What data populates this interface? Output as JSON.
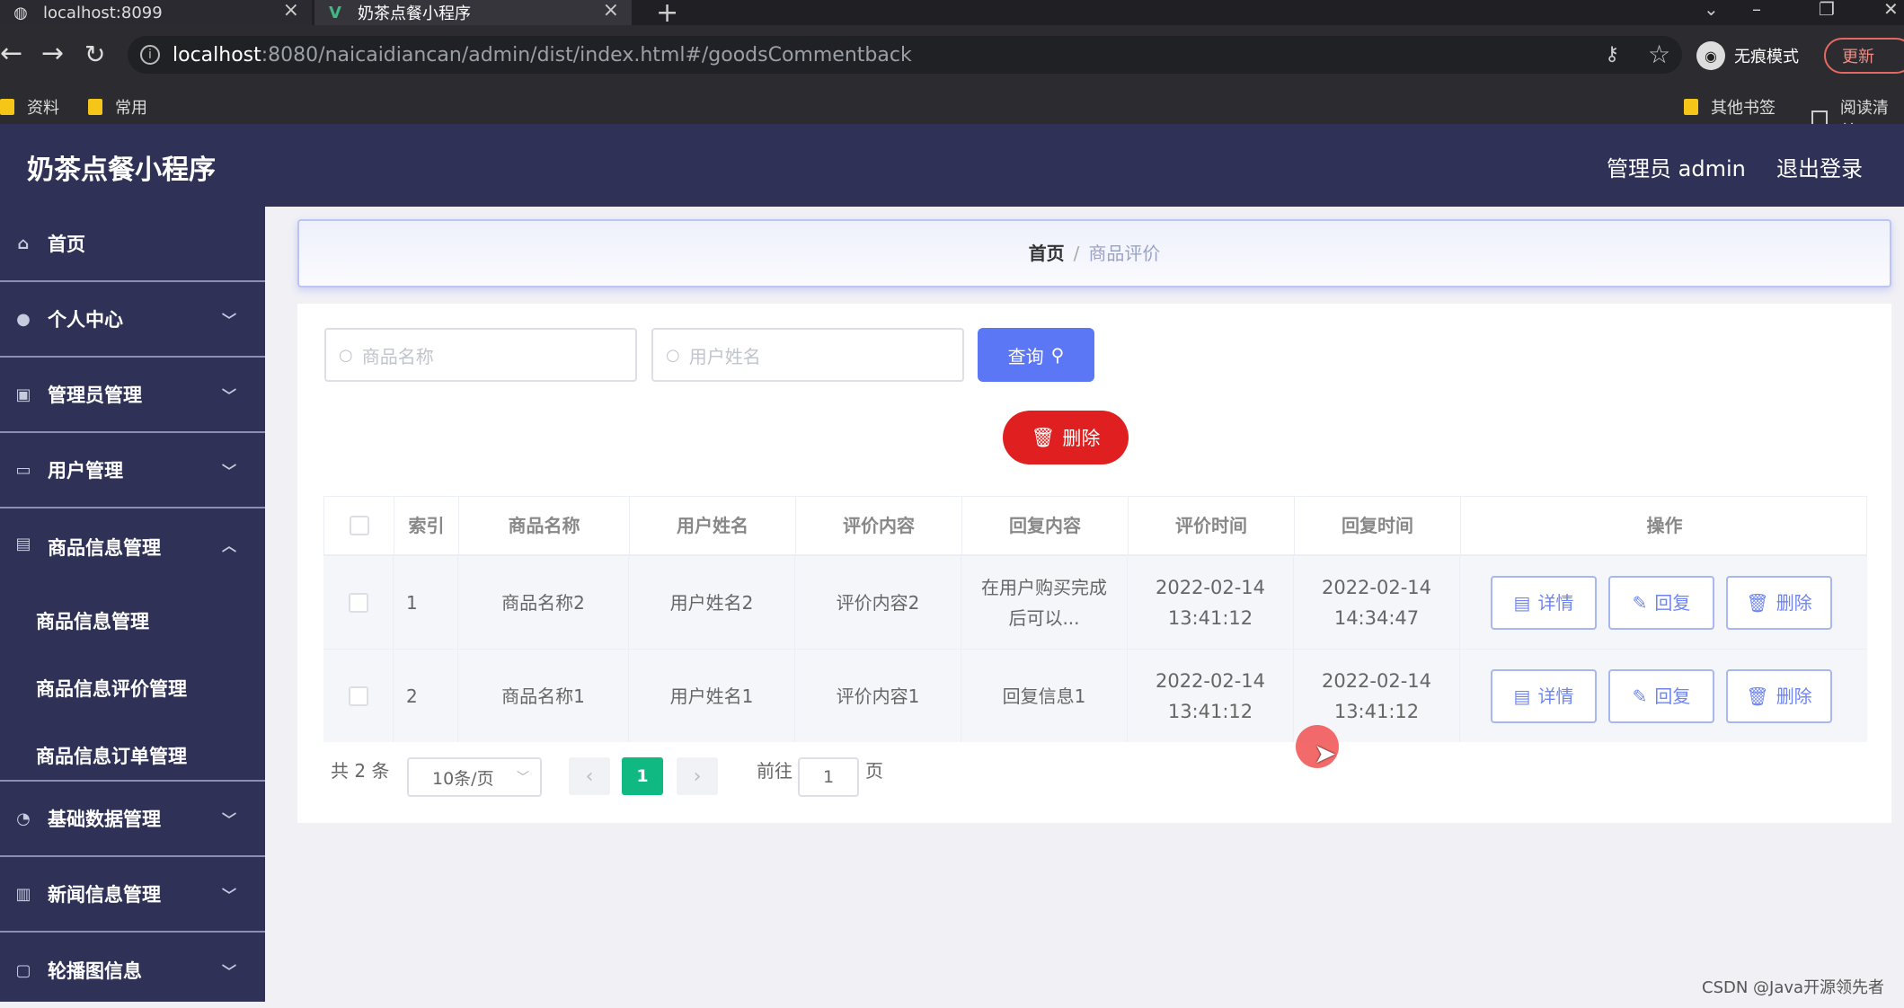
{
  "browser": {
    "tabs": [
      {
        "title": "localhost:8099",
        "close": "×"
      },
      {
        "title": "奶茶点餐小程序",
        "close": "×"
      }
    ],
    "new_tab": "+",
    "url_host": "localhost",
    "url_path": ":8080/naicaidiancan/admin/dist/index.html#/goodsCommentback",
    "incognito_label": "无痕模式",
    "update_label": "更新",
    "bookmarks": [
      "资料",
      "常用",
      "其他书签",
      "阅读清单"
    ]
  },
  "header": {
    "title": "奶茶点餐小程序",
    "admin": "管理员 admin",
    "logout": "退出登录"
  },
  "sidebar": {
    "items": [
      {
        "label": "首页"
      },
      {
        "label": "个人中心"
      },
      {
        "label": "管理员管理"
      },
      {
        "label": "用户管理"
      },
      {
        "label": "商品信息管理"
      },
      {
        "label": "基础数据管理"
      },
      {
        "label": "新闻信息管理"
      },
      {
        "label": "轮播图信息"
      }
    ],
    "sub_items": [
      "商品信息管理",
      "商品信息评价管理",
      "商品信息订单管理"
    ]
  },
  "breadcrumb": {
    "home": "首页",
    "sep": "/",
    "current": "商品评价"
  },
  "search": {
    "goods_placeholder": "商品名称",
    "user_placeholder": "用户姓名",
    "query_label": "查询"
  },
  "delete_label": "删除",
  "table": {
    "headers": [
      "索引",
      "商品名称",
      "用户姓名",
      "评价内容",
      "回复内容",
      "评价时间",
      "回复时间",
      "操作"
    ],
    "rows": [
      {
        "index": "1",
        "goods": "商品名称2",
        "user": "用户姓名2",
        "comment": "评价内容2",
        "reply": "在用户购买完成后可以...",
        "comment_time": "2022-02-14 13:41:12",
        "reply_time": "2022-02-14 14:34:47"
      },
      {
        "index": "2",
        "goods": "商品名称1",
        "user": "用户姓名1",
        "comment": "评价内容1",
        "reply": "回复信息1",
        "comment_time": "2022-02-14 13:41:12",
        "reply_time": "2022-02-14 13:41:12"
      }
    ],
    "actions": {
      "detail": "详情",
      "reply": "回复",
      "delete": "删除"
    }
  },
  "pagination": {
    "total": "共 2 条",
    "page_size": "10条/页",
    "current": "1",
    "goto_prefix": "前往",
    "goto_value": "1",
    "goto_suffix": "页"
  },
  "watermark": "CSDN @Java开源领先者"
}
